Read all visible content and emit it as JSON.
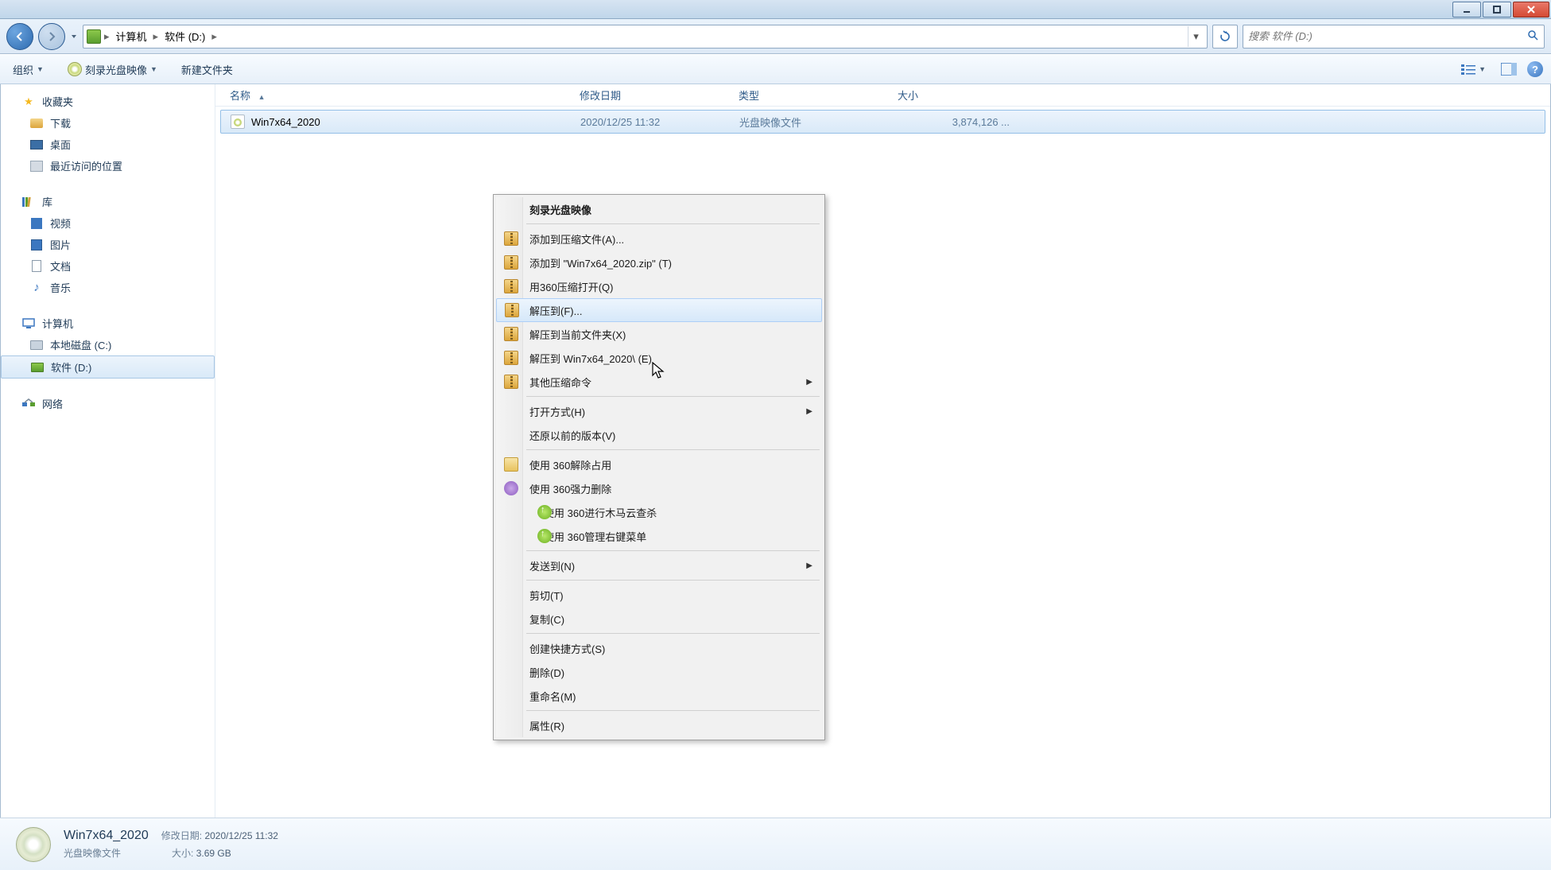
{
  "titlebar": {},
  "nav": {
    "path": {
      "seg1": "计算机",
      "seg2": "软件 (D:)"
    },
    "search_placeholder": "搜索 软件 (D:)"
  },
  "toolbar": {
    "organize": "组织",
    "burn": "刻录光盘映像",
    "newfolder": "新建文件夹"
  },
  "sidebar": {
    "favorites": {
      "label": "收藏夹",
      "items": [
        "下载",
        "桌面",
        "最近访问的位置"
      ]
    },
    "libraries": {
      "label": "库",
      "items": [
        "视频",
        "图片",
        "文档",
        "音乐"
      ]
    },
    "computer": {
      "label": "计算机",
      "items": [
        "本地磁盘 (C:)",
        "软件 (D:)"
      ]
    },
    "network": {
      "label": "网络"
    }
  },
  "columns": {
    "name": "名称",
    "date": "修改日期",
    "type": "类型",
    "size": "大小"
  },
  "file": {
    "name": "Win7x64_2020",
    "date": "2020/12/25 11:32",
    "type": "光盘映像文件",
    "size": "3,874,126 ..."
  },
  "context": {
    "burn": "刻录光盘映像",
    "add_archive": "添加到压缩文件(A)...",
    "add_zip": "添加到 \"Win7x64_2020.zip\" (T)",
    "open_360": "用360压缩打开(Q)",
    "extract_to": "解压到(F)...",
    "extract_here": "解压到当前文件夹(X)",
    "extract_folder": "解压到 Win7x64_2020\\ (E)",
    "other_zip": "其他压缩命令",
    "open_with": "打开方式(H)",
    "restore": "还原以前的版本(V)",
    "unlock360": "使用 360解除占用",
    "delete360": "使用 360强力删除",
    "scan360": "使用 360进行木马云查杀",
    "menu360": "使用 360管理右键菜单",
    "sendto": "发送到(N)",
    "cut": "剪切(T)",
    "copy": "复制(C)",
    "shortcut": "创建快捷方式(S)",
    "delete": "删除(D)",
    "rename": "重命名(M)",
    "properties": "属性(R)"
  },
  "details": {
    "name": "Win7x64_2020",
    "type": "光盘映像文件",
    "date_label": "修改日期:",
    "date": "2020/12/25 11:32",
    "size_label": "大小:",
    "size": "3.69 GB"
  }
}
